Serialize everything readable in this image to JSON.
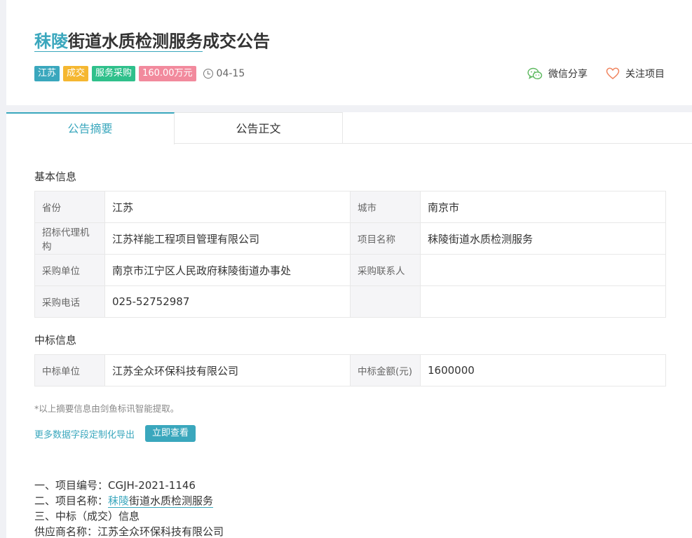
{
  "header": {
    "title_prefix": "秣陵",
    "title_rest": "街道水质检测服务",
    "title_suffix": "成交公告",
    "tags": {
      "province": "江苏",
      "type": "成交",
      "category": "服务采购",
      "amount": "160.00万元"
    },
    "date": "04-15",
    "actions": {
      "share_label": "微信分享",
      "follow_label": "关注项目"
    }
  },
  "tabs": {
    "summary": "公告摘要",
    "fulltext": "公告正文"
  },
  "basic": {
    "heading": "基本信息",
    "rows": [
      {
        "l1": "省份",
        "v1": "江苏",
        "l2": "城市",
        "v2": "南京市"
      },
      {
        "l1": "招标代理机构",
        "v1": "江苏祥能工程项目管理有限公司",
        "l2": "项目名称",
        "v2": "秣陵街道水质检测服务"
      },
      {
        "l1": "采购单位",
        "v1": "南京市江宁区人民政府秣陵街道办事处",
        "l2": "采购联系人",
        "v2": ""
      },
      {
        "l1": "采购电话",
        "v1": "025-52752987",
        "l2": "",
        "v2": ""
      }
    ]
  },
  "award": {
    "heading": "中标信息",
    "rows": [
      {
        "l1": "中标单位",
        "v1": "江苏全众环保科技有限公司",
        "l2": "中标金额(元)",
        "v2": "1600000"
      }
    ]
  },
  "note": "*以上摘要信息由剑鱼标讯智能提取。",
  "export": {
    "link": "更多数据字段定制化导出",
    "button": "立即查看"
  },
  "body": {
    "line1": "一、项目编号：CGJH-2021-1146",
    "line2_prefix": "二、项目名称：",
    "line2_hl": "秣陵",
    "line2_rest": "街道水质检测服务",
    "line3": "三、中标（成交）信息",
    "line4": "供应商名称：江苏全众环保科技有限公司"
  },
  "colors": {
    "accent": "#3aa7bd",
    "tag_province": "#3aa7bd",
    "tag_type": "#f5b731",
    "tag_category": "#2fc08b",
    "tag_amount": "#f28a9d",
    "share_icon": "#5bb85d",
    "heart_icon": "#f0845f"
  }
}
